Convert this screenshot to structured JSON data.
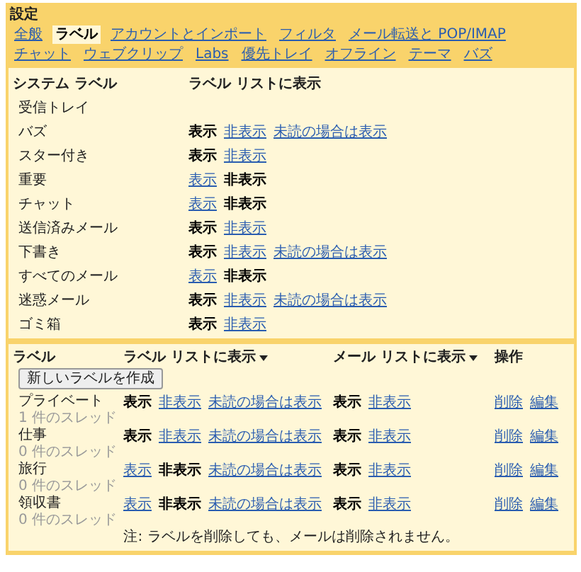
{
  "title": "設定",
  "tabs": [
    {
      "label": "全般",
      "selected": false
    },
    {
      "label": "ラベル",
      "selected": true
    },
    {
      "label": "アカウントとインポート",
      "selected": false
    },
    {
      "label": "フィルタ",
      "selected": false
    },
    {
      "label": "メール転送と POP/IMAP",
      "selected": false
    },
    {
      "label": "チャット",
      "selected": false
    },
    {
      "label": "ウェブクリップ",
      "selected": false
    },
    {
      "label": "Labs",
      "selected": false
    },
    {
      "label": "優先トレイ",
      "selected": false
    },
    {
      "label": "オフライン",
      "selected": false
    },
    {
      "label": "テーマ",
      "selected": false
    },
    {
      "label": "バズ",
      "selected": false
    }
  ],
  "system_labels": {
    "header_name": "システム ラベル",
    "header_list": "ラベル リストに表示",
    "rows": [
      {
        "name": "受信トレイ",
        "options": []
      },
      {
        "name": "バズ",
        "options": [
          {
            "label": "表示",
            "selected": true
          },
          {
            "label": "非表示",
            "selected": false
          },
          {
            "label": "未読の場合は表示",
            "selected": false
          }
        ]
      },
      {
        "name": "スター付き",
        "options": [
          {
            "label": "表示",
            "selected": true
          },
          {
            "label": "非表示",
            "selected": false
          }
        ]
      },
      {
        "name": "重要",
        "options": [
          {
            "label": "表示",
            "selected": false
          },
          {
            "label": "非表示",
            "selected": true
          }
        ]
      },
      {
        "name": "チャット",
        "options": [
          {
            "label": "表示",
            "selected": false
          },
          {
            "label": "非表示",
            "selected": true
          }
        ]
      },
      {
        "name": "送信済みメール",
        "options": [
          {
            "label": "表示",
            "selected": true
          },
          {
            "label": "非表示",
            "selected": false
          }
        ]
      },
      {
        "name": "下書き",
        "options": [
          {
            "label": "表示",
            "selected": true
          },
          {
            "label": "非表示",
            "selected": false
          },
          {
            "label": "未読の場合は表示",
            "selected": false
          }
        ]
      },
      {
        "name": "すべてのメール",
        "options": [
          {
            "label": "表示",
            "selected": false
          },
          {
            "label": "非表示",
            "selected": true
          }
        ]
      },
      {
        "name": "迷惑メール",
        "options": [
          {
            "label": "表示",
            "selected": true
          },
          {
            "label": "非表示",
            "selected": false
          },
          {
            "label": "未読の場合は表示",
            "selected": false
          }
        ]
      },
      {
        "name": "ゴミ箱",
        "options": [
          {
            "label": "表示",
            "selected": true
          },
          {
            "label": "非表示",
            "selected": false
          }
        ]
      }
    ]
  },
  "labels": {
    "header_name": "ラベル",
    "header_list": "ラベル リストに表示",
    "header_mail": "メール リストに表示",
    "header_actions": "操作",
    "create_button": "新しいラベルを作成",
    "rows": [
      {
        "name": "プライベート",
        "threads": "1 件のスレッド",
        "list_options": [
          {
            "label": "表示",
            "selected": true
          },
          {
            "label": "非表示",
            "selected": false
          },
          {
            "label": "未読の場合は表示",
            "selected": false
          }
        ],
        "mail_options": [
          {
            "label": "表示",
            "selected": true
          },
          {
            "label": "非表示",
            "selected": false
          }
        ],
        "actions": [
          "削除",
          "編集"
        ]
      },
      {
        "name": "仕事",
        "threads": "0 件のスレッド",
        "list_options": [
          {
            "label": "表示",
            "selected": true
          },
          {
            "label": "非表示",
            "selected": false
          },
          {
            "label": "未読の場合は表示",
            "selected": false
          }
        ],
        "mail_options": [
          {
            "label": "表示",
            "selected": true
          },
          {
            "label": "非表示",
            "selected": false
          }
        ],
        "actions": [
          "削除",
          "編集"
        ]
      },
      {
        "name": "旅行",
        "threads": "0 件のスレッド",
        "list_options": [
          {
            "label": "表示",
            "selected": false
          },
          {
            "label": "非表示",
            "selected": true
          },
          {
            "label": "未読の場合は表示",
            "selected": false
          }
        ],
        "mail_options": [
          {
            "label": "表示",
            "selected": true
          },
          {
            "label": "非表示",
            "selected": false
          }
        ],
        "actions": [
          "削除",
          "編集"
        ]
      },
      {
        "name": "領収書",
        "threads": "0 件のスレッド",
        "list_options": [
          {
            "label": "表示",
            "selected": false
          },
          {
            "label": "非表示",
            "selected": true
          },
          {
            "label": "未読の場合は表示",
            "selected": false
          }
        ],
        "mail_options": [
          {
            "label": "表示",
            "selected": true
          },
          {
            "label": "非表示",
            "selected": false
          }
        ],
        "actions": [
          "削除",
          "編集"
        ]
      }
    ],
    "note": "注: ラベルを削除しても、メールは削除されません。"
  }
}
